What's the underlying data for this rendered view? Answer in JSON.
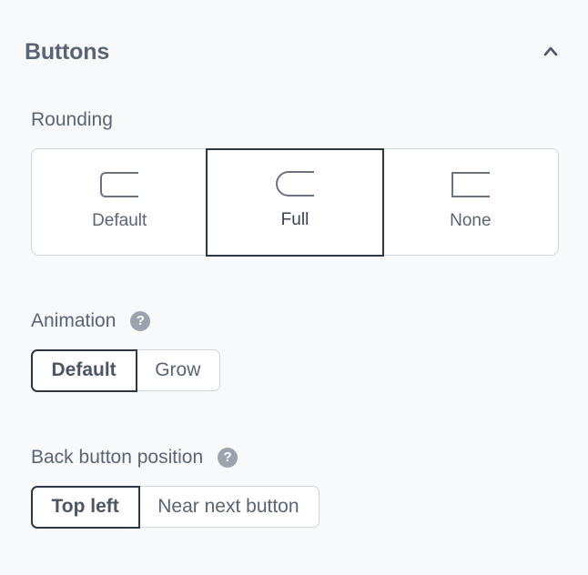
{
  "section": {
    "title": "Buttons",
    "collapse_icon": "chevron-up-icon"
  },
  "rounding": {
    "label": "Rounding",
    "options": [
      {
        "label": "Default",
        "icon": "rounded-rect-icon",
        "selected": false
      },
      {
        "label": "Full",
        "icon": "pill-rect-icon",
        "selected": true
      },
      {
        "label": "None",
        "icon": "square-rect-icon",
        "selected": false
      }
    ]
  },
  "animation": {
    "label": "Animation",
    "help_icon": "question-circle-icon",
    "help_glyph": "?",
    "options": [
      {
        "label": "Default",
        "selected": true
      },
      {
        "label": "Grow",
        "selected": false
      }
    ]
  },
  "back_button": {
    "label": "Back button position",
    "help_icon": "question-circle-icon",
    "help_glyph": "?",
    "options": [
      {
        "label": "Top left",
        "selected": true
      },
      {
        "label": "Near next button",
        "selected": false
      }
    ]
  },
  "colors": {
    "background": "#f8f9fb",
    "text": "#5b6473",
    "selected_border": "#2f3743",
    "border": "#d1d5db",
    "help_icon_bg": "#9ca3af"
  }
}
